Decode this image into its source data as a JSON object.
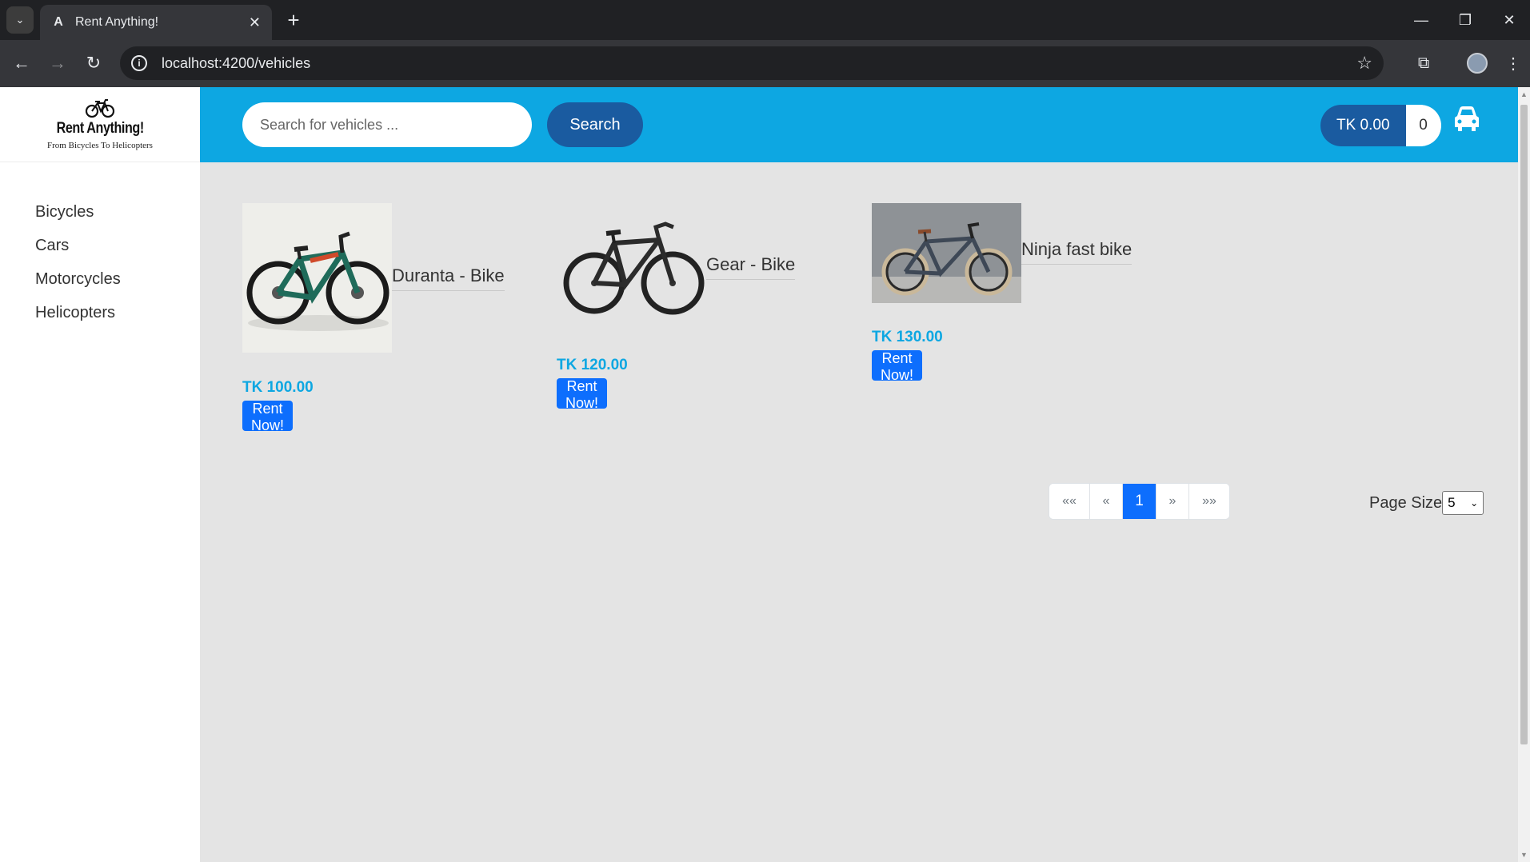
{
  "browser": {
    "tab_title": "Rent Anything!",
    "url": "localhost:4200/vehicles",
    "new_tab": "+"
  },
  "logo": {
    "title": "Rent Anything!",
    "subtitle": "From Bicycles To Helicopters"
  },
  "sidebar": {
    "items": [
      {
        "label": "Bicycles"
      },
      {
        "label": "Cars"
      },
      {
        "label": "Motorcycles"
      },
      {
        "label": "Helicopters"
      }
    ]
  },
  "header": {
    "search_placeholder": "Search for vehicles ...",
    "search_button": "Search",
    "cart_total": "TK 0.00",
    "cart_count": "0"
  },
  "products": [
    {
      "name": "Duranta - Bike",
      "price": "TK 100.00",
      "button": "Rent Now!"
    },
    {
      "name": "Gear - Bike",
      "price": "TK 120.00",
      "button": "Rent Now!"
    },
    {
      "name": "Ninja fast bike",
      "price": "TK 130.00",
      "button": "Rent Now!"
    }
  ],
  "pagination": {
    "first": "««",
    "prev": "«",
    "current": "1",
    "next": "»",
    "last": "»»"
  },
  "page_size": {
    "label": "Page Size",
    "value": "5"
  },
  "colors": {
    "header_bg": "#0da7e2",
    "accent_dark": "#1a5ba0",
    "button_primary": "#0d6efd",
    "price": "#0da7e2"
  }
}
